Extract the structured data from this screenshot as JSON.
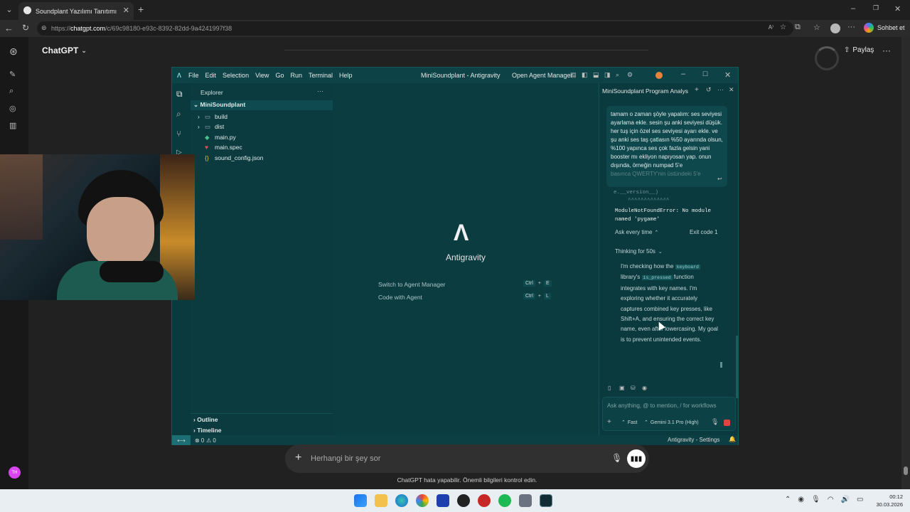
{
  "browser": {
    "tab_title": "Soundplant Yazılımı Tanıtımı",
    "url_prefix": "https://",
    "url_domain": "chatgpt.com",
    "url_path": "/c/69c98180-e93c-8392-82dd-9a4241997f38",
    "profile_label": "Sohbet et"
  },
  "chatgpt": {
    "title": "ChatGPT",
    "share_label": "Paylaş",
    "composer_placeholder": "Herhangi bir şey sor",
    "disclaimer": "ChatGPT hata yapabilir. Önemli bilgileri kontrol edin.",
    "avatar_initials": "TH"
  },
  "ide": {
    "menu": [
      "File",
      "Edit",
      "Selection",
      "View",
      "Go",
      "Run",
      "Terminal",
      "Help"
    ],
    "window_title": "MiniSoundplant - Antigravity",
    "agent_manager": "Open Agent Manager",
    "explorer": {
      "title": "Explorer",
      "root": "MiniSoundplant",
      "items": [
        {
          "name": "build",
          "kind": "folder"
        },
        {
          "name": "dist",
          "kind": "folder"
        },
        {
          "name": "main.py",
          "kind": "python"
        },
        {
          "name": "main.spec",
          "kind": "spec"
        },
        {
          "name": "sound_config.json",
          "kind": "json"
        }
      ],
      "outline": "Outline",
      "timeline": "Timeline"
    },
    "editor": {
      "brand": "Antigravity",
      "shortcuts": [
        {
          "label": "Switch to Agent Manager",
          "mod": "Ctrl",
          "key": "E"
        },
        {
          "label": "Code with Agent",
          "mod": "Ctrl",
          "key": "L"
        }
      ]
    },
    "agent": {
      "title": "MiniSoundplant Program Analys",
      "user_message": "tamam o zaman şöyle yapalım: ses seviyesi ayarlama ekle. sesin şu anki seviyesi düşük. her tuş için özel ses seviyesi ayarı ekle. ve şu anki ses taş çatlasın %50 ayarında olsun, %100 yapınca ses çok fazla gelsin yani booster mı ekliyon napıyosan yap. onun dışında, örneğin numpad 5'e",
      "user_message_fade": "basınca QWERTY'nin üstündeki 5'e",
      "code_tail_1": "e.__version__)",
      "code_tail_2": "^^^^^^^^^^^^^",
      "error_text": "ModuleNotFoundError: No module named 'pygame'",
      "ask_label": "Ask every time",
      "exit_label": "Exit code 1",
      "thinking_label": "Thinking for 50s",
      "thought_pre": "I'm checking how the",
      "thought_code1": "keyboard",
      "thought_mid1": "library's",
      "thought_code2": "is_pressed",
      "thought_post": "function integrates with key names. I'm exploring whether it accurately captures combined key presses, like Shift+A, and ensuring the correct key name, even after lowercasing. My goal is to prevent unintended events.",
      "input_placeholder": "Ask anything, @ to mention, / for workflows",
      "mode_label": "Fast",
      "model_label": "Gemini 3.1 Pro (High)"
    },
    "status": {
      "errors": "0",
      "warnings": "0",
      "right_label": "Antigravity - Settings"
    }
  },
  "taskbar": {
    "time": "00:12",
    "date": "30.03.2026"
  },
  "colors": {
    "ide_bg": "#0a3b3f",
    "accent_red": "#e0443a",
    "chat_bg": "#212121"
  }
}
